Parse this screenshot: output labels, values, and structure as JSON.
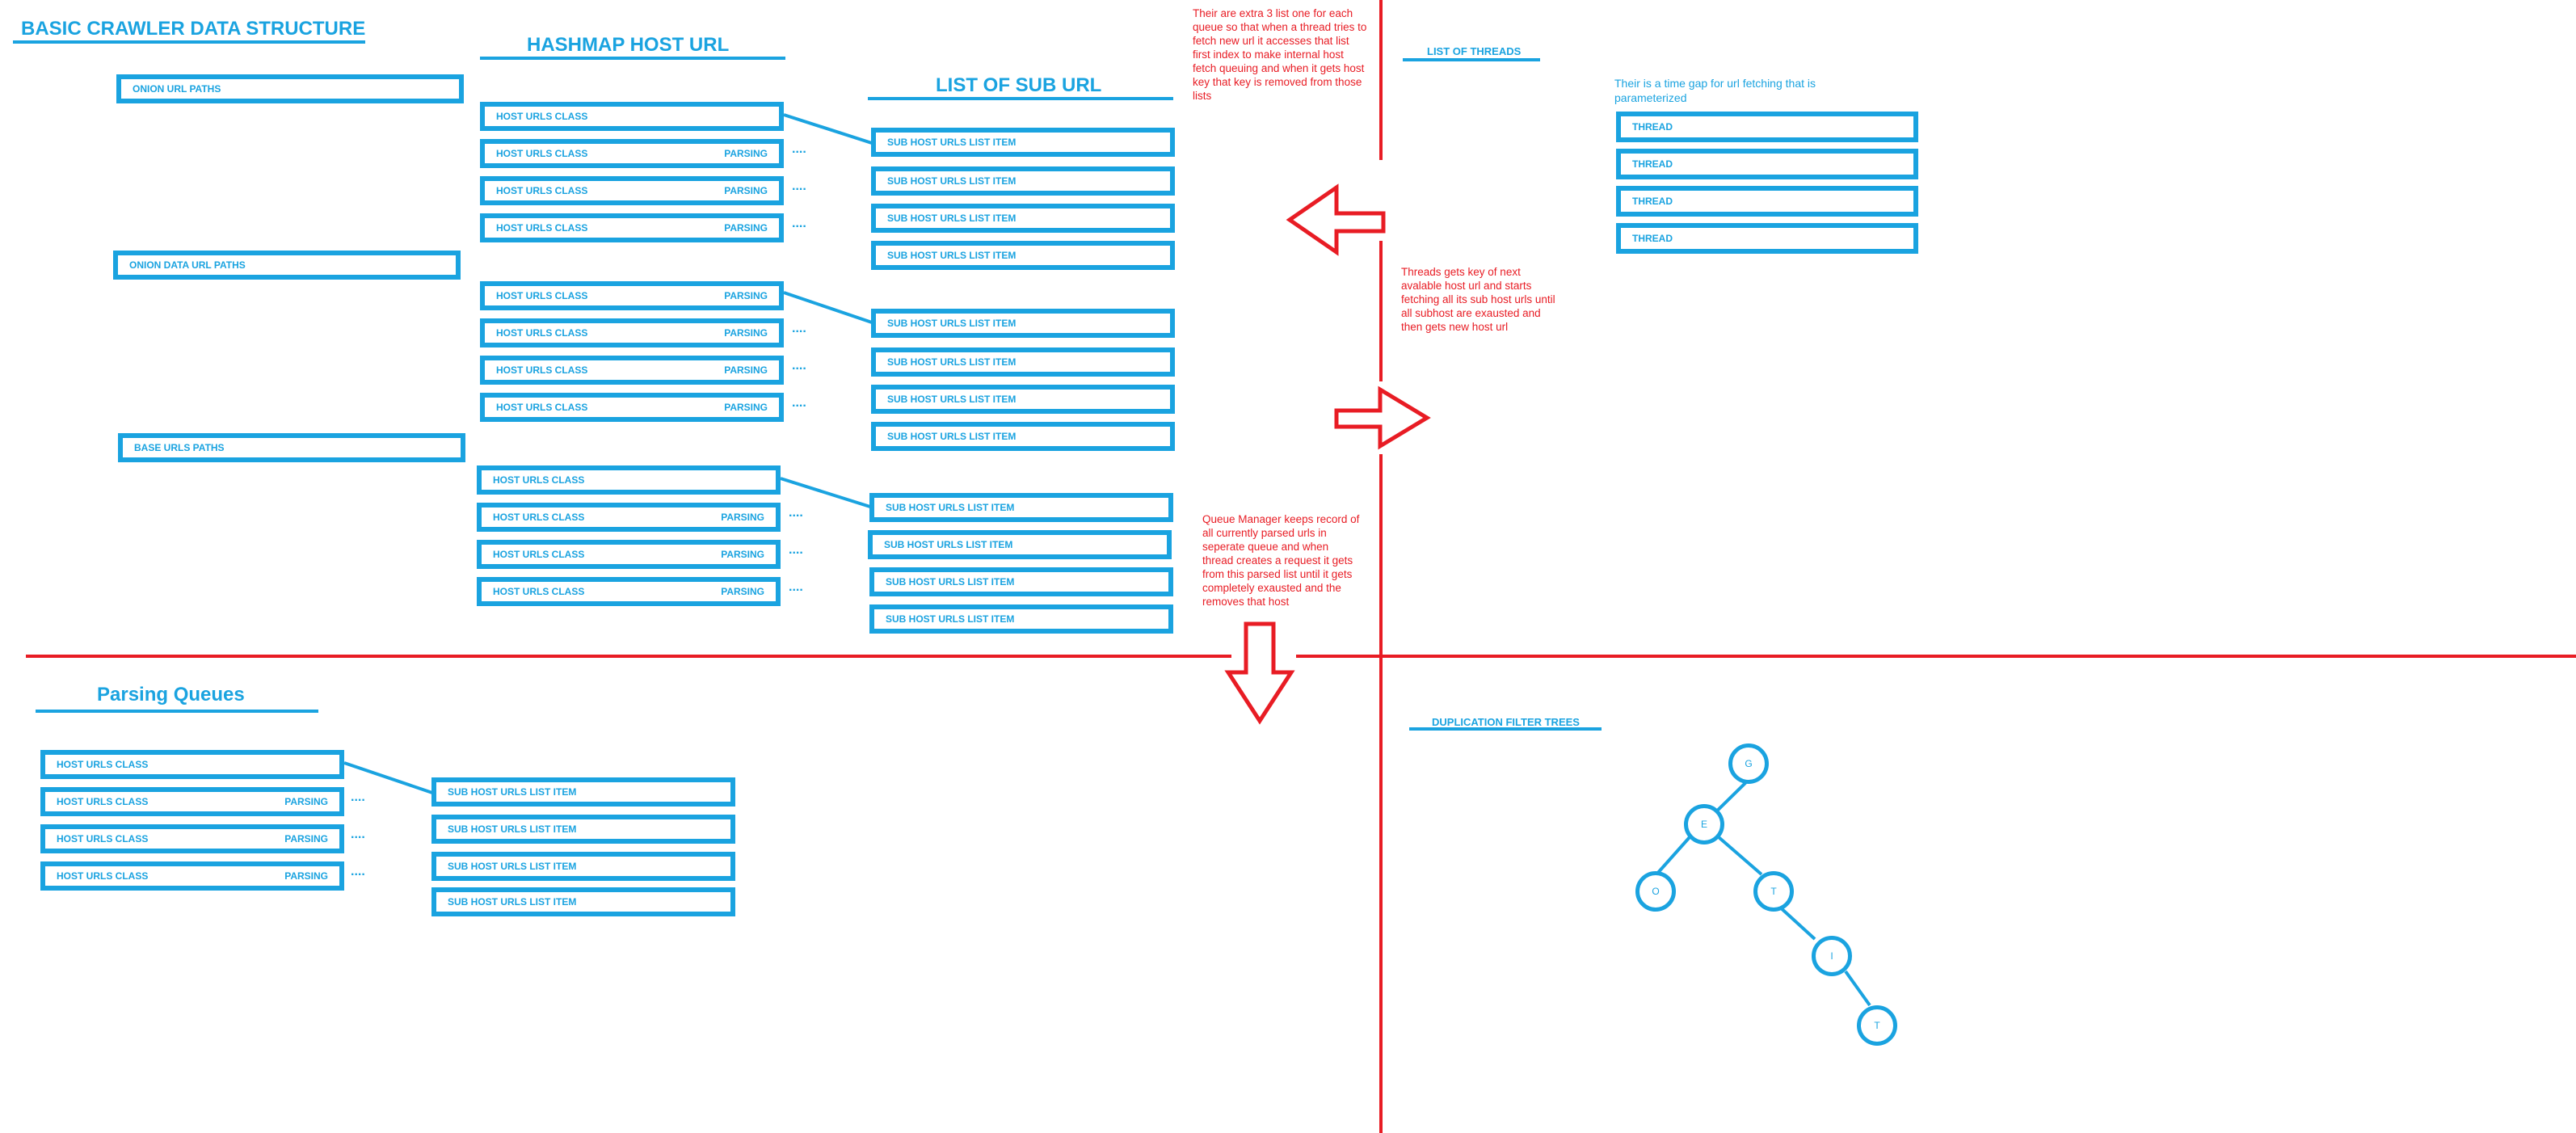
{
  "headings": {
    "basic": "BASIC CRAWLER DATA STRUCTURE",
    "hashmap": "HASHMAP HOST URL",
    "sub_url": "LIST OF SUB URL",
    "threads": "LIST OF THREADS",
    "parsing_queues": "Parsing Queues",
    "dup_filter": "DUPLICATION FILTER TREES"
  },
  "paths": [
    "ONION URL PATHS",
    "ONION DATA URL PATHS",
    "BASE URLS PATHS"
  ],
  "host_urls_class": "HOST URLS CLASS",
  "parsing_tag": "PARSING",
  "ellipsis": "....",
  "sub_item": "SUB HOST URLS LIST ITEM",
  "thread_label": "THREAD",
  "notes": {
    "extra_lists": "Their are extra 3 list one for each queue so that when a thread tries to fetch new url it accesses that list first index to make internal host fetch queuing and when it gets host key that key is removed from those lists",
    "threads_gets": "Threads gets key of next avalable host url and starts fetching all its sub host urls until all subhost are exausted and then gets new host url",
    "queue_manager": "Queue Manager keeps record of all currently parsed urls in seperate queue and when thread creates a request it gets from this parsed list until it gets completely exausted and the removes that host",
    "time_gap": "Their is a time gap for url fetching that is parameterized"
  },
  "tree_nodes": [
    "G",
    "E",
    "O",
    "T",
    "I",
    "T"
  ],
  "colors": {
    "blue": "#1aa3e0",
    "red": "#e81c24"
  }
}
